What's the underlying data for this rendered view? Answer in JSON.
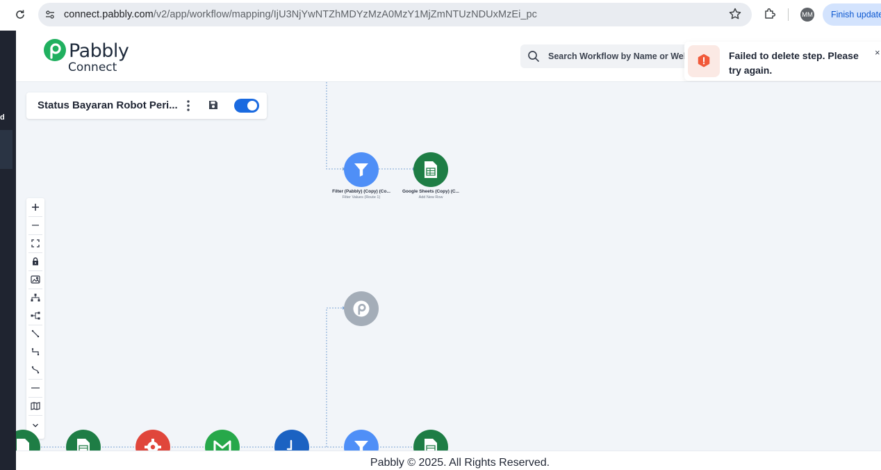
{
  "browser": {
    "url_host": "connect.pabbly.com",
    "url_path": "/v2/app/workflow/mapping/IjU3NjYwNTZhMDYzMzA0MzY1MjZmNTUzNDUxMzEi_pc",
    "profile_initials": "MM",
    "finish_update_label": "Finish update"
  },
  "left_strip": {
    "partial_char": "d"
  },
  "header": {
    "logo_word": "Pabbly",
    "logo_sub": "Connect",
    "search_placeholder": "Search Workflow by Name or Webhook"
  },
  "toast": {
    "message": "Failed to delete step. Please try again.",
    "close_glyph": "×",
    "type": "error",
    "accent_color": "#f15a3a"
  },
  "workflow": {
    "title": "Status Bayaran Robot Peri...",
    "enabled": true
  },
  "nodes": {
    "filter_copy": {
      "title": "Filter (Pabbly) (Copy) (Co...",
      "subtitle": "Filter Values (Route 1)",
      "color": "#4f8ff7"
    },
    "sheets_copy": {
      "title": "Google Sheets (Copy) (C...",
      "subtitle": "Add New Row",
      "color": "#1e7d45"
    },
    "router": {
      "color": "#a4adb8"
    }
  },
  "toolbar": {
    "tools": [
      "zoom-in",
      "zoom-out",
      "fit-view",
      "lock",
      "image-export",
      "vertical-layout",
      "horizontal-layout",
      "straight-connector",
      "step-connector",
      "smooth-connector",
      "line",
      "minimap",
      "collapse"
    ]
  },
  "footer": {
    "text": "Pabbly © 2025. All Rights Reserved."
  }
}
